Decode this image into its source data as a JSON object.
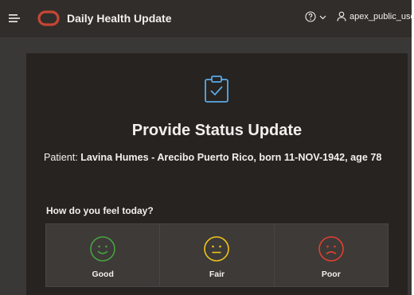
{
  "header": {
    "app_title": "Daily Health Update",
    "user_name": "apex_public_user",
    "icons": [
      "menu-icon",
      "oracle-logo",
      "help-icon",
      "chevron-down-icon",
      "user-icon"
    ]
  },
  "card": {
    "icon": "clipboard-check-icon",
    "title": "Provide Status Update",
    "patient_label": "Patient:",
    "patient_value": "Lavina Humes - Arecibo Puerto Rico, born 11-NOV-1942, age 78",
    "question": "How do you feel today?",
    "options": [
      {
        "label": "Good",
        "icon": "smile-icon",
        "color": "#48a23f"
      },
      {
        "label": "Fair",
        "icon": "neutral-face-icon",
        "color": "#f0c419"
      },
      {
        "label": "Poor",
        "icon": "frown-icon",
        "color": "#e0412f"
      }
    ]
  },
  "colors": {
    "header_bg": "#312d2a",
    "page_bg": "#3a3836",
    "card_bg": "#262321",
    "option_bg": "#3d3a38",
    "accent_blue": "#5aa9e6",
    "oracle_red": "#c74634"
  }
}
